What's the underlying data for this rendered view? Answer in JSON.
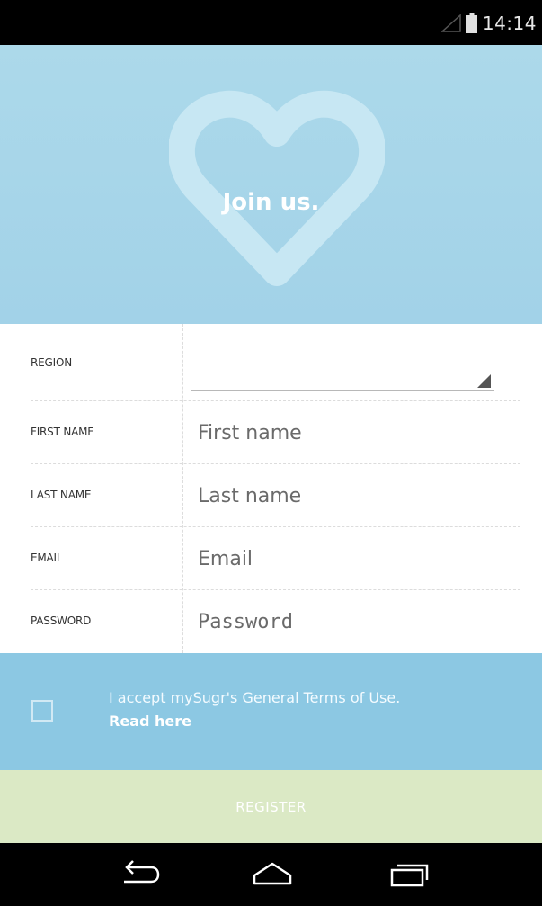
{
  "status_bar": {
    "time": "14:14",
    "icons": [
      "signal-icon",
      "battery-icon"
    ]
  },
  "hero": {
    "title": "Join us.",
    "icon": "heart-icon"
  },
  "form": {
    "region": {
      "label": "REGION",
      "value": ""
    },
    "first_name": {
      "label": "FIRST NAME",
      "placeholder": "First name",
      "value": ""
    },
    "last_name": {
      "label": "LAST NAME",
      "placeholder": "Last name",
      "value": ""
    },
    "email": {
      "label": "EMAIL",
      "placeholder": "Email",
      "value": ""
    },
    "password": {
      "label": "PASSWORD",
      "placeholder": "Password",
      "value": ""
    }
  },
  "terms": {
    "checked": false,
    "text": "I accept mySugr's General Terms of Use.",
    "link_label": "Read here"
  },
  "register_button": {
    "label": "REGISTER"
  },
  "nav_bar": {
    "icons": [
      "back-icon",
      "home-icon",
      "recent-apps-icon"
    ]
  },
  "colors": {
    "hero_background": "#a8d6ea",
    "terms_background": "#8cc8e3",
    "register_background": "#dbe9c5",
    "system_bars": "#000000"
  }
}
